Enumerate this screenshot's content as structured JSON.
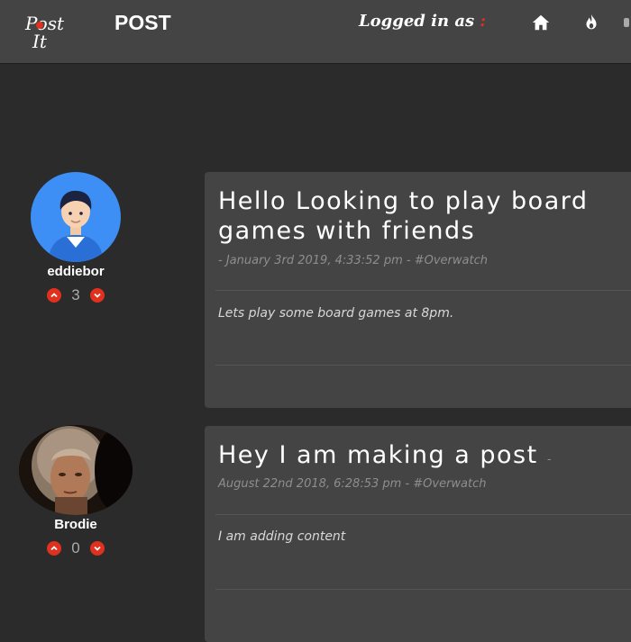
{
  "nav": {
    "logo_line1": "Post",
    "logo_line2": "It",
    "title": "POST",
    "logged_in_label": "Logged in as",
    "logged_in_colon": ":",
    "home_icon": "home-icon",
    "fire_icon": "fire-icon"
  },
  "posts": [
    {
      "author": "eddiebor",
      "votes": "3",
      "title": "Hello Looking to play board games with friends",
      "meta": "- January 3rd 2019, 4:33:52 pm - #Overwatch",
      "content": "Lets play some board games at 8pm."
    },
    {
      "author": "Brodie",
      "votes": "0",
      "title": "Hey I am making a post",
      "title_suffix": "-",
      "meta": "August 22nd 2018, 6:28:53 pm - #Overwatch",
      "content": "I am adding content"
    }
  ],
  "colors": {
    "accent": "#e0301e",
    "card_bg": "#444444",
    "page_bg": "#2b2b2b"
  }
}
